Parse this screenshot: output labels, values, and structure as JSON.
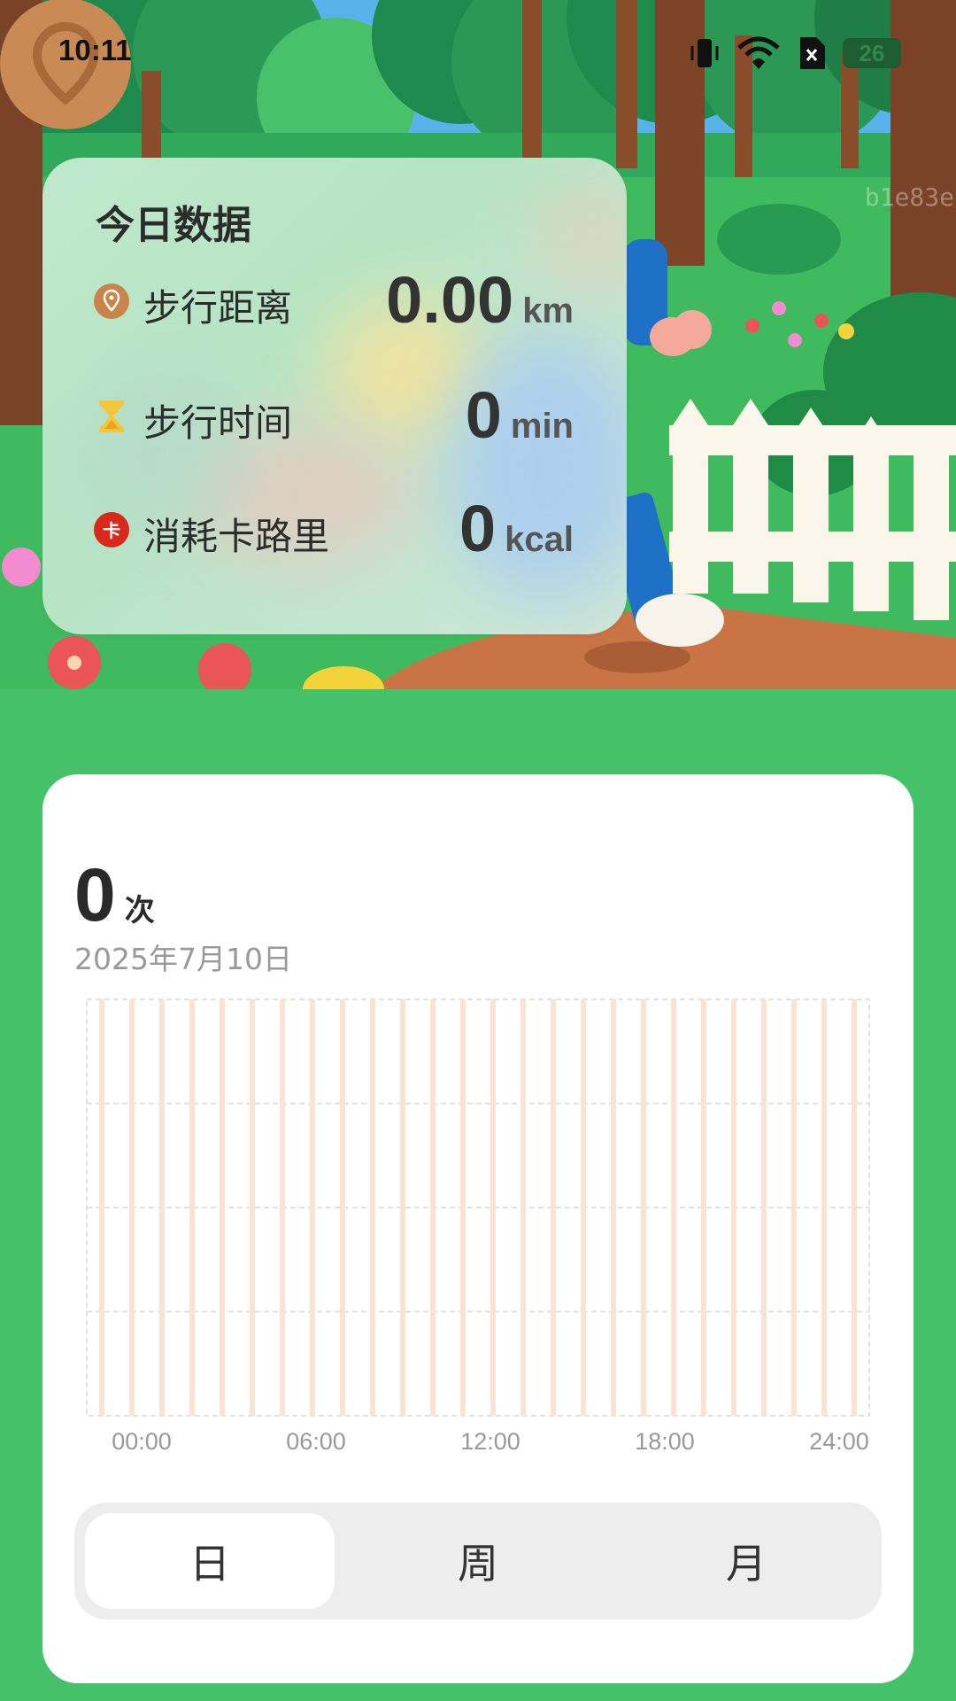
{
  "status_bar": {
    "time": "10:11",
    "battery": "26",
    "icons": [
      "vibrate-icon",
      "wifi-icon",
      "sim-off-icon",
      "battery-icon"
    ]
  },
  "watermark": "b1e83e",
  "today_card": {
    "title": "今日数据",
    "stats": [
      {
        "label": "步行距离",
        "value": "0.00",
        "unit": "km",
        "icon": "location-pin-icon",
        "icon_color": "#c9844a"
      },
      {
        "label": "步行时间",
        "value": "0",
        "unit": "min",
        "icon": "hourglass-icon",
        "icon_color": "#f2c83a"
      },
      {
        "label": "消耗卡路里",
        "value": "0",
        "unit": "kcal",
        "icon": "calorie-icon",
        "icon_color": "#d9281c",
        "icon_text": "卡"
      }
    ]
  },
  "summary": {
    "count": "0",
    "count_unit": "次",
    "date": "2025年7月10日"
  },
  "chart_data": {
    "type": "bar",
    "x_tick_labels": [
      "00:00",
      "06:00",
      "12:00",
      "18:00",
      "24:00"
    ],
    "hours": [
      0,
      1,
      2,
      3,
      4,
      5,
      6,
      7,
      8,
      9,
      10,
      11,
      12,
      13,
      14,
      15,
      16,
      17,
      18,
      19,
      20,
      21,
      22,
      23,
      24,
      25
    ],
    "values": [
      0,
      0,
      0,
      0,
      0,
      0,
      0,
      0,
      0,
      0,
      0,
      0,
      0,
      0,
      0,
      0,
      0,
      0,
      0,
      0,
      0,
      0,
      0,
      0,
      0,
      0
    ],
    "xlim": [
      0,
      24
    ],
    "grid": true,
    "bar_color": "#fbe3d4"
  },
  "period_tabs": {
    "selected": 0,
    "items": [
      {
        "label": "日"
      },
      {
        "label": "周"
      },
      {
        "label": "月"
      }
    ]
  },
  "colors": {
    "page_background": "#45c16a",
    "card_background": "#ffffff",
    "segment_track": "#ededed"
  }
}
